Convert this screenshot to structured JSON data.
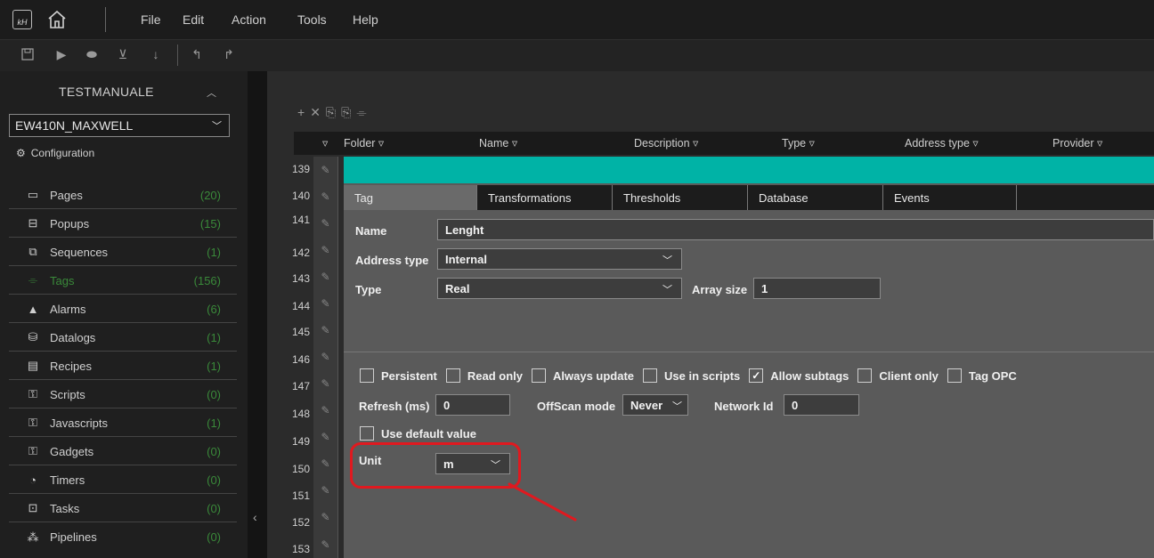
{
  "menubar": {
    "logo_text": "kH",
    "items": [
      "File",
      "Edit",
      "Action",
      "Tools",
      "Help"
    ]
  },
  "sidebar": {
    "project": "TESTMANUALE",
    "device": "EW410N_MAXWELL",
    "config_label": "Configuration",
    "items": [
      {
        "label": "Pages",
        "count": "(20)",
        "icon": "pages-icon"
      },
      {
        "label": "Popups",
        "count": "(15)",
        "icon": "popups-icon"
      },
      {
        "label": "Sequences",
        "count": "(1)",
        "icon": "sequences-icon"
      },
      {
        "label": "Tags",
        "count": "(156)",
        "icon": "tags-icon"
      },
      {
        "label": "Alarms",
        "count": "(6)",
        "icon": "alarm-icon"
      },
      {
        "label": "Datalogs",
        "count": "(1)",
        "icon": "database-icon"
      },
      {
        "label": "Recipes",
        "count": "(1)",
        "icon": "recipes-icon"
      },
      {
        "label": "Scripts",
        "count": "(0)",
        "icon": "scripts-icon"
      },
      {
        "label": "Javascripts",
        "count": "(1)",
        "icon": "javascripts-icon"
      },
      {
        "label": "Gadgets",
        "count": "(0)",
        "icon": "gadgets-icon"
      },
      {
        "label": "Timers",
        "count": "(0)",
        "icon": "timer-icon"
      },
      {
        "label": "Tasks",
        "count": "(0)",
        "icon": "tasks-icon"
      },
      {
        "label": "Pipelines",
        "count": "(0)",
        "icon": "pipelines-icon"
      }
    ]
  },
  "grid": {
    "columns": [
      "Folder ▿",
      "Name ▿",
      "Description ▿",
      "Type ▿",
      "Address type ▿",
      "Provider ▿"
    ],
    "row_numbers": [
      "139",
      "140",
      "141",
      "142",
      "143",
      "144",
      "145",
      "146",
      "147",
      "148",
      "149",
      "150",
      "151",
      "152",
      "153"
    ]
  },
  "editor": {
    "tabs": [
      "Tag",
      "Transformations",
      "Thresholds",
      "Database",
      "Events"
    ],
    "name_label": "Name",
    "name_value": "Lenght",
    "address_type_label": "Address type",
    "address_type_value": "Internal",
    "type_label": "Type",
    "type_value": "Real",
    "array_size_label": "Array size",
    "array_size_value": "1",
    "checkboxes": [
      {
        "label": "Persistent",
        "checked": false
      },
      {
        "label": "Read only",
        "checked": false
      },
      {
        "label": "Always update",
        "checked": false
      },
      {
        "label": "Use in scripts",
        "checked": false
      },
      {
        "label": "Allow subtags",
        "checked": true
      },
      {
        "label": "Client only",
        "checked": false
      },
      {
        "label": "Tag OPC",
        "checked": false
      }
    ],
    "refresh_label": "Refresh (ms)",
    "refresh_value": "0",
    "offscan_label": "OffScan mode",
    "offscan_value": "Never",
    "network_label": "Network Id",
    "network_value": "0",
    "default_value_label": "Use default value",
    "unit_label": "Unit",
    "unit_value": "m"
  },
  "colors": {
    "accent_teal": "#00b3a6",
    "active_green": "#3a8a3a",
    "annotation_red": "#e0191f"
  }
}
